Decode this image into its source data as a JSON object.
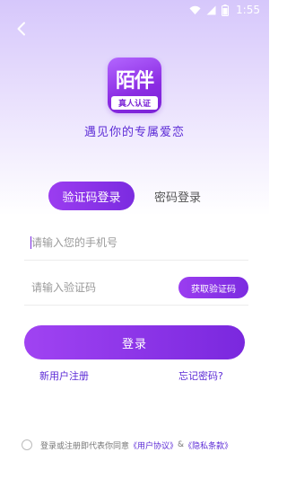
{
  "status_bar": {
    "time": "1:55",
    "icons": [
      "wifi-icon",
      "signal-icon",
      "battery-icon"
    ]
  },
  "header": {
    "back_icon": "chevron-left-icon"
  },
  "logo": {
    "main_text": "陌伴",
    "sub_text": "真人认证"
  },
  "slogan": "遇见你的专属爱恋",
  "tabs": [
    {
      "label": "验证码登录",
      "active": true
    },
    {
      "label": "密码登录",
      "active": false
    }
  ],
  "form": {
    "phone_placeholder": "请输入您的手机号",
    "phone_value": "",
    "code_placeholder": "请输入验证码",
    "code_value": "",
    "get_code_label": "获取验证码"
  },
  "login_label": "登录",
  "links": {
    "register": "新用户注册",
    "forgot": "忘记密码?"
  },
  "agreement": {
    "prefix": "登录或注册即代表你同意",
    "user_agreement": "《用户协议》",
    "separator": "&",
    "privacy": "《隐私条款》"
  },
  "colors": {
    "accent": "#7b2be0",
    "accent_light": "#9b3df0",
    "text_accent": "#5c2bd6",
    "background_top": "#d6c7fb"
  }
}
